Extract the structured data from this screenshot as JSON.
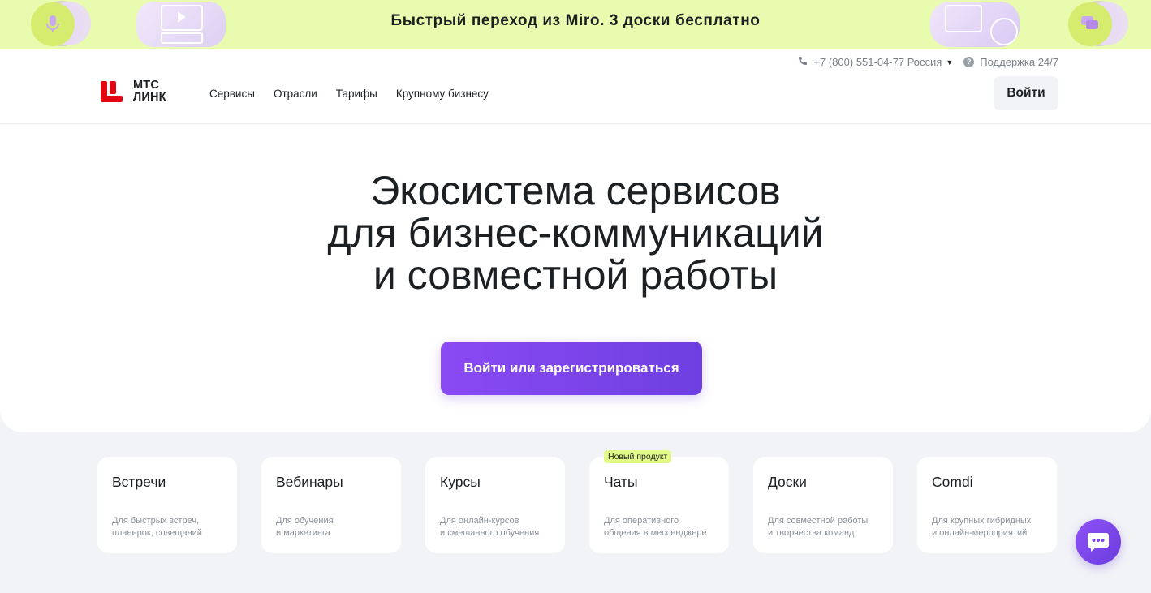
{
  "promo": {
    "text": "Быстрый переход из Miro. 3 доски бесплатно",
    "icons": [
      "microphone-icon",
      "video-icon",
      "board-icon",
      "chat-icon"
    ]
  },
  "header": {
    "phone": "+7 (800) 551-04-77 Россия",
    "support": "Поддержка 24/7",
    "logo_line1": "МТС",
    "logo_line2": "ЛИНК",
    "nav": [
      "Сервисы",
      "Отрасли",
      "Тарифы",
      "Крупному бизнесу"
    ],
    "login_label": "Войти"
  },
  "hero": {
    "title_lines": [
      "Экосистема сервисов",
      "для бизнес-коммуникаций",
      "и совместной работы"
    ],
    "cta_label": "Войти или зарегистрироваться"
  },
  "cards": [
    {
      "title": "Встречи",
      "desc": "Для быстрых встреч,\nпланерок, совещаний",
      "badge": ""
    },
    {
      "title": "Вебинары",
      "desc": "Для обучения\nи маркетинга",
      "badge": ""
    },
    {
      "title": "Курсы",
      "desc": "Для онлайн-курсов\nи смешанного обучения",
      "badge": ""
    },
    {
      "title": "Чаты",
      "desc": "Для оперативного\nобщения в мессенджере",
      "badge": "Новый продукт"
    },
    {
      "title": "Доски",
      "desc": "Для совместной работы\nи творчества команд",
      "badge": ""
    },
    {
      "title": "Comdi",
      "desc": "Для крупных гибридных\nи онлайн-мероприятий",
      "badge": ""
    }
  ],
  "colors": {
    "promo_bg": "#e8fbae",
    "brand_red": "#e30611",
    "cta_purple": "#7b45ec",
    "badge_green": "#e2fa8a"
  }
}
